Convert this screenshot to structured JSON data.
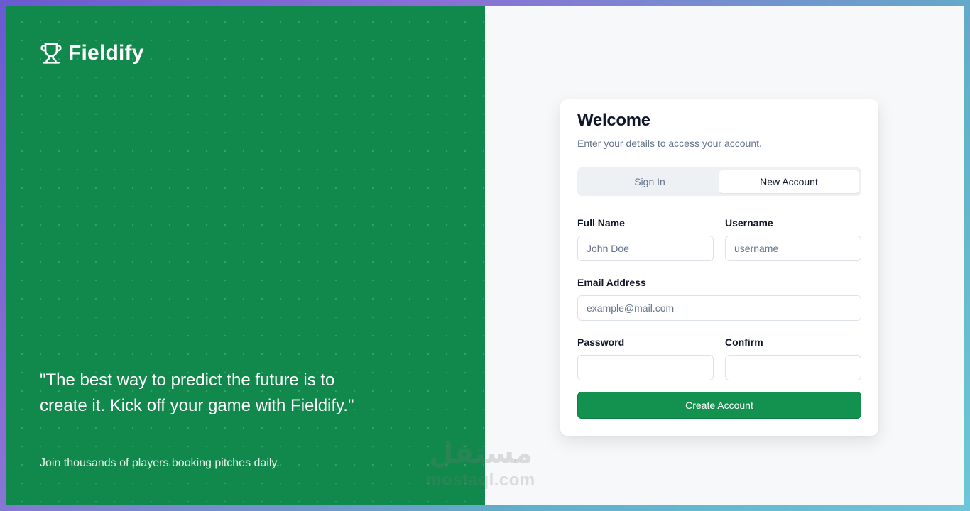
{
  "brand": {
    "name": "Fieldify",
    "icon": "trophy-icon"
  },
  "hero": {
    "quote": "\"The best way to predict the future is to create it. Kick off your game with Fieldify.\"",
    "tagline": "Join thousands of players booking pitches daily."
  },
  "card": {
    "title": "Welcome",
    "subtitle": "Enter your details to access your account.",
    "tabs": [
      {
        "label": "Sign In",
        "active": false
      },
      {
        "label": "New Account",
        "active": true
      }
    ],
    "fields": {
      "full_name": {
        "label": "Full Name",
        "placeholder": "John Doe",
        "value": ""
      },
      "username": {
        "label": "Username",
        "placeholder": "username",
        "value": ""
      },
      "email": {
        "label": "Email Address",
        "placeholder": "example@mail.com",
        "value": ""
      },
      "password": {
        "label": "Password",
        "placeholder": "",
        "value": ""
      },
      "confirm": {
        "label": "Confirm",
        "placeholder": "",
        "value": ""
      }
    },
    "submit_label": "Create Account"
  },
  "watermark": {
    "arabic": "مستقل",
    "latin": "mostaql.com"
  },
  "colors": {
    "brand_green": "#11894d",
    "button_green": "#13914f",
    "panel_bg": "#f7f8fa"
  }
}
